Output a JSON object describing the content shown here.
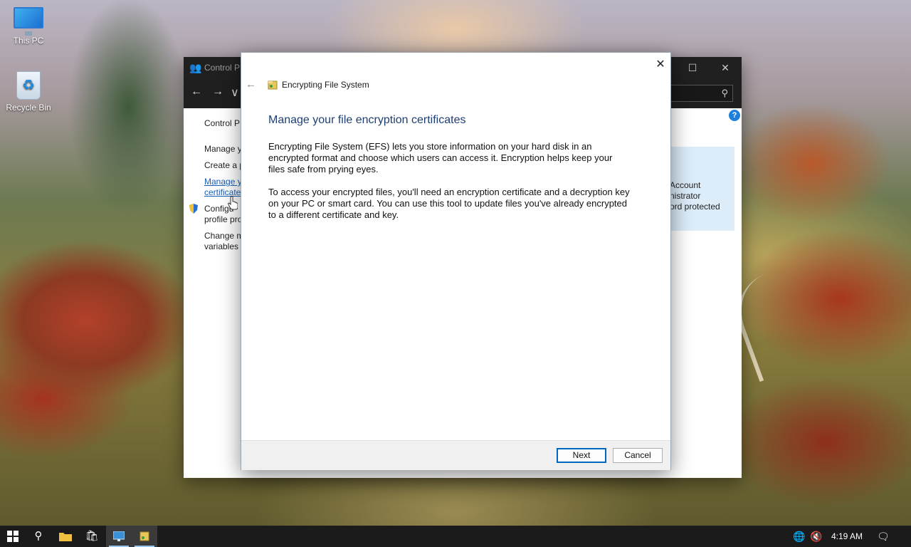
{
  "desktop": {
    "icons": [
      {
        "label": "This PC"
      },
      {
        "label": "Recycle Bin"
      }
    ]
  },
  "control_panel": {
    "title": "Control P",
    "breadcrumb": "Control P",
    "links": [
      {
        "line1": "Manage y"
      },
      {
        "line1": "Create a p"
      },
      {
        "line1": "Manage y",
        "line2": "certificate"
      },
      {
        "line1": "Configu",
        "line2": "profile pro"
      },
      {
        "line1": "Change m",
        "line2": "variables"
      }
    ],
    "panel_lines": [
      "Account",
      "nistrator",
      "ord protected"
    ],
    "help_label": "?"
  },
  "efs_dialog": {
    "app_title": "Encrypting File System",
    "heading": "Manage your file encryption certificates",
    "paragraph1": "Encrypting File System (EFS) lets you store information on your hard disk in an encrypted format and choose which users can access it. Encryption helps keep your files safe from prying eyes.",
    "paragraph2": "To access your encrypted files, you'll need an encryption certificate and a decryption key on your PC or smart card. You can use this tool to update files you've already encrypted to a different certificate and key.",
    "next_label": "Next",
    "cancel_label": "Cancel"
  },
  "taskbar": {
    "items": [
      "start-icon",
      "search-icon",
      "file-explorer-icon",
      "store-icon",
      "control-panel-icon",
      "encrypting-file-system-icon"
    ],
    "clock": "4:19 AM"
  },
  "colors": {
    "heading": "#1d3f73",
    "link": "#1a5fb4",
    "accent": "#0067c0",
    "taskbar": "#1b1b1b"
  }
}
